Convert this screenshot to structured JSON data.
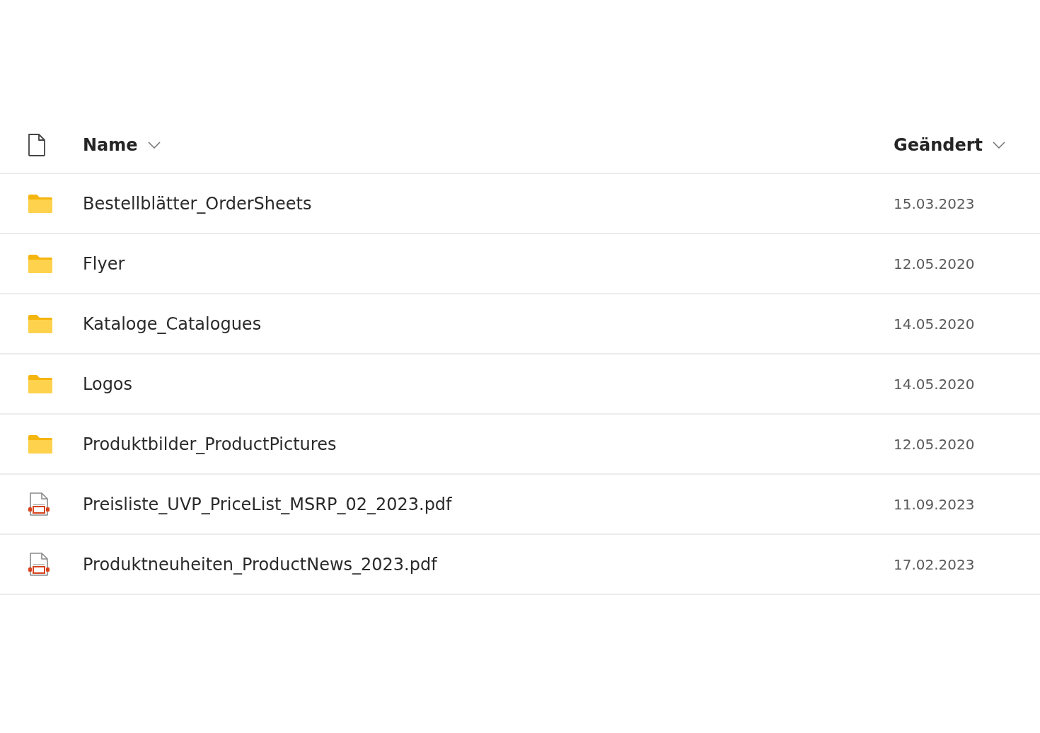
{
  "table": {
    "columns": [
      {
        "kind": "type"
      },
      {
        "kind": "text",
        "label": "Name"
      },
      {
        "kind": "text",
        "label": "Geändert"
      }
    ],
    "rows": [
      {
        "kind": "folder",
        "name": "Bestellblätter_OrderSheets",
        "modified": "15.03.2023"
      },
      {
        "kind": "folder",
        "name": "Flyer",
        "modified": "12.05.2020"
      },
      {
        "kind": "folder",
        "name": "Kataloge_Catalogues",
        "modified": "14.05.2020"
      },
      {
        "kind": "folder",
        "name": "Logos",
        "modified": "14.05.2020"
      },
      {
        "kind": "folder",
        "name": "Produktbilder_ProductPictures",
        "modified": "12.05.2020"
      },
      {
        "kind": "pdf",
        "name": "Preisliste_UVP_PriceList_MSRP_02_2023.pdf",
        "modified": "11.09.2023"
      },
      {
        "kind": "pdf",
        "name": "Produktneuheiten_ProductNews_2023.pdf",
        "modified": "17.02.2023"
      }
    ]
  }
}
